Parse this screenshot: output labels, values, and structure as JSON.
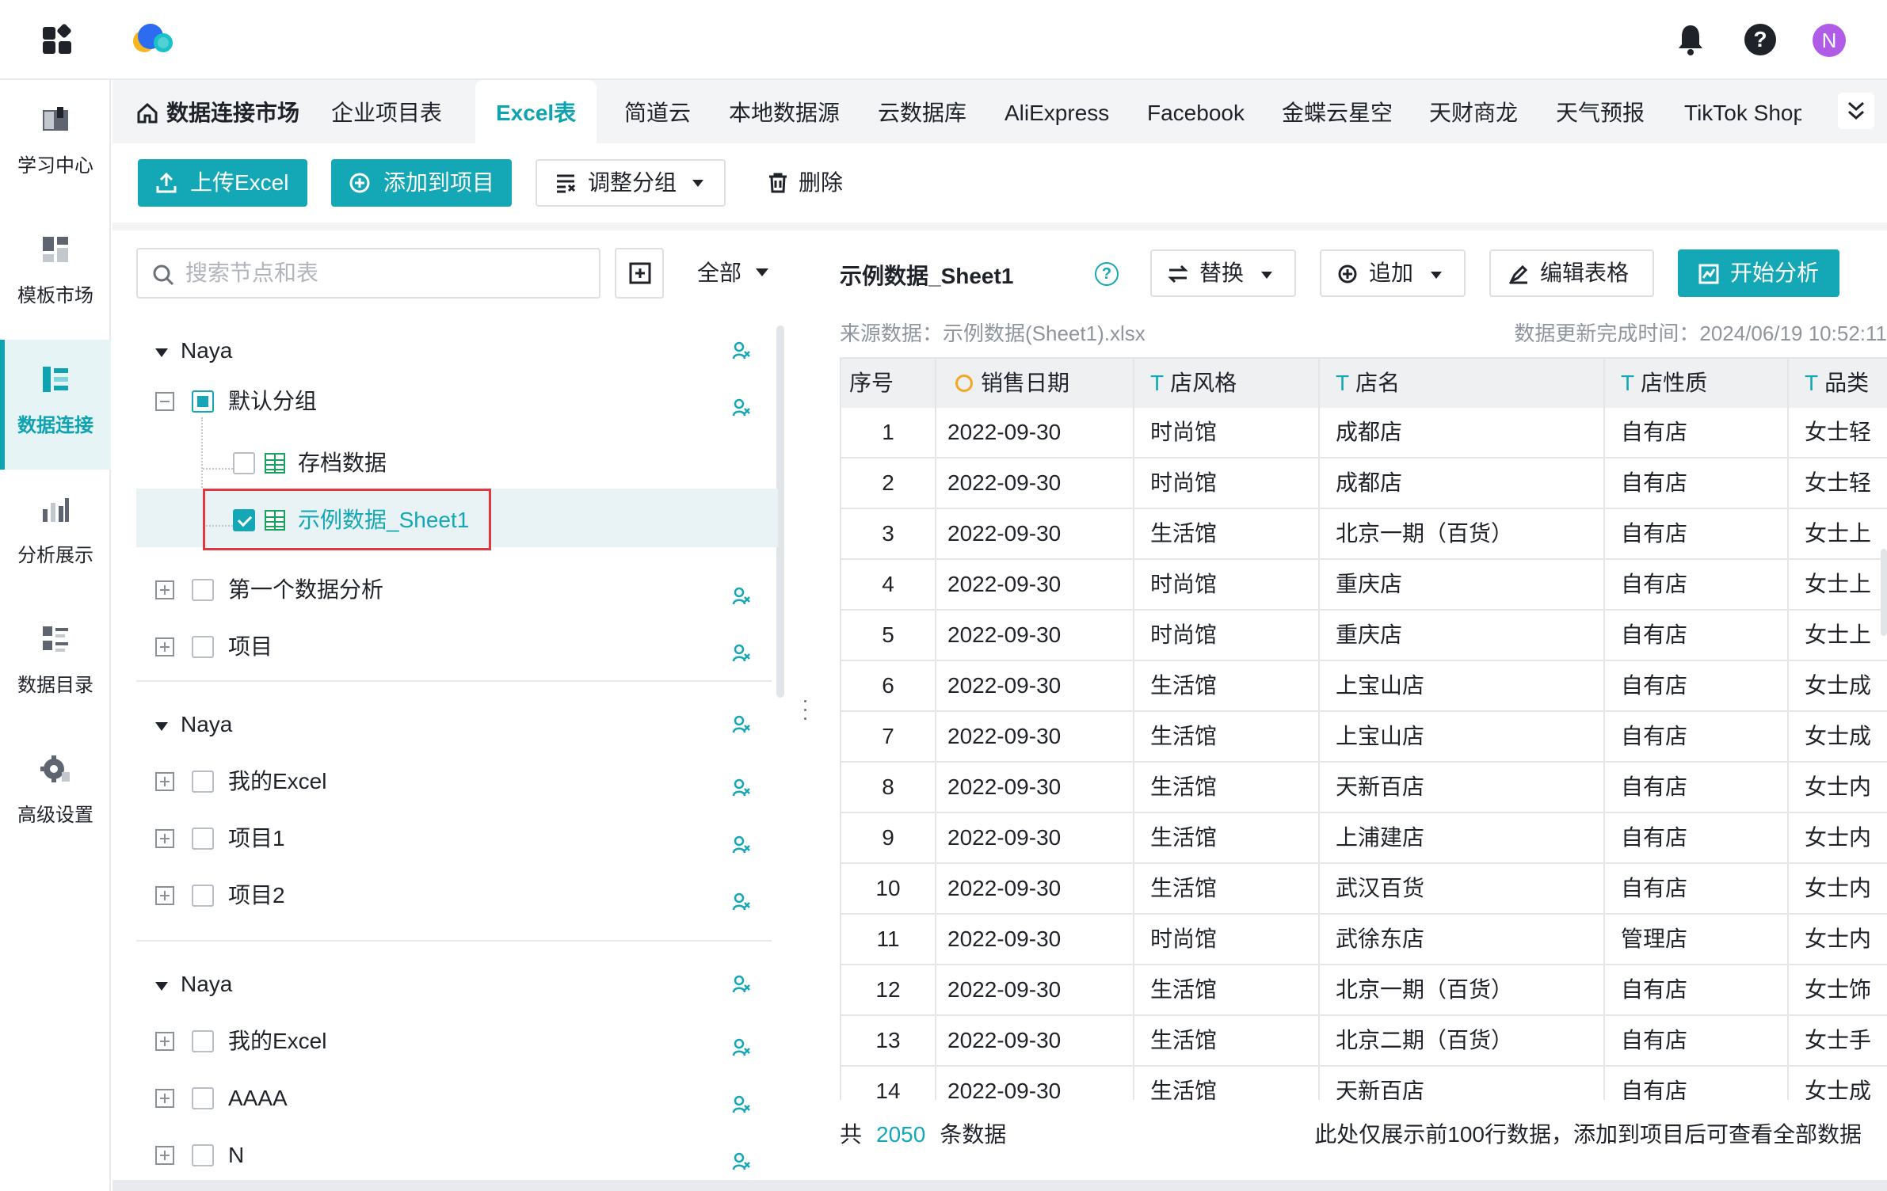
{
  "topbar": {
    "icons": [
      "apps-grid-icon",
      "cloud-logo-icon",
      "bell-icon",
      "help-icon",
      "user-avatar"
    ],
    "help_glyph": "?",
    "avatar_letter": "N"
  },
  "sidebar": {
    "items": [
      {
        "label": "学习中心",
        "icon": "book-icon"
      },
      {
        "label": "模板市场",
        "icon": "template-icon"
      },
      {
        "label": "数据连接",
        "icon": "data-connect-icon",
        "active": true
      },
      {
        "label": "分析展示",
        "icon": "chart-icon"
      },
      {
        "label": "数据目录",
        "icon": "catalog-icon"
      },
      {
        "label": "高级设置",
        "icon": "gear-icon"
      }
    ]
  },
  "tabs": {
    "home": "数据连接市场",
    "items": [
      "企业项目表",
      "Excel表",
      "简道云",
      "本地数据源",
      "云数据库",
      "AliExpress",
      "Facebook",
      "金蝶云星空",
      "天财商龙",
      "天气预报",
      "TikTok Shop"
    ],
    "active": "Excel表"
  },
  "toolbar": {
    "upload": "上传Excel",
    "add_to_project": "添加到项目",
    "adjust_group": "调整分组",
    "delete": "删除"
  },
  "tree": {
    "search_placeholder": "搜索节点和表",
    "filter": "全部",
    "sections": [
      {
        "owner": "Naya",
        "nodes": [
          {
            "label": "默认分组",
            "state": "partial",
            "expand": "minus"
          },
          {
            "label": "存档数据",
            "state": "unchecked",
            "leaf": true
          },
          {
            "label": "示例数据_Sheet1",
            "state": "checked",
            "leaf": true,
            "selected": true
          },
          {
            "label": "第一个数据分析",
            "state": "unchecked",
            "expand": "plus"
          },
          {
            "label": "项目",
            "state": "unchecked",
            "expand": "plus"
          }
        ]
      },
      {
        "owner": "Naya",
        "nodes": [
          {
            "label": "我的Excel",
            "state": "unchecked",
            "expand": "plus"
          },
          {
            "label": "项目1",
            "state": "unchecked",
            "expand": "plus"
          },
          {
            "label": "项目2",
            "state": "unchecked",
            "expand": "plus"
          }
        ]
      },
      {
        "owner": "Naya",
        "nodes": [
          {
            "label": "我的Excel",
            "state": "unchecked",
            "expand": "plus"
          },
          {
            "label": "AAAA",
            "state": "unchecked",
            "expand": "plus"
          },
          {
            "label": "N",
            "state": "unchecked",
            "expand": "plus"
          }
        ]
      }
    ]
  },
  "preview": {
    "title": "示例数据_Sheet1",
    "buttons": {
      "replace": "替换",
      "append": "追加",
      "edit_table": "编辑表格",
      "start_analysis": "开始分析"
    },
    "source_label": "来源数据：示例数据(Sheet1).xlsx",
    "update_label": "数据更新完成时间：2024/06/19 10:52:11",
    "columns": [
      {
        "name": "序号",
        "type": ""
      },
      {
        "name": "销售日期",
        "type": "date"
      },
      {
        "name": "店风格",
        "type": "text"
      },
      {
        "name": "店名",
        "type": "text"
      },
      {
        "name": "店性质",
        "type": "text"
      },
      {
        "name": "品类",
        "type": "text"
      }
    ],
    "type_glyph": "T",
    "rows": [
      [
        "1",
        "2022-09-30",
        "时尚馆",
        "成都店",
        "自有店",
        "女士轻"
      ],
      [
        "2",
        "2022-09-30",
        "时尚馆",
        "成都店",
        "自有店",
        "女士轻"
      ],
      [
        "3",
        "2022-09-30",
        "生活馆",
        "北京一期（百货）",
        "自有店",
        "女士上"
      ],
      [
        "4",
        "2022-09-30",
        "时尚馆",
        "重庆店",
        "自有店",
        "女士上"
      ],
      [
        "5",
        "2022-09-30",
        "时尚馆",
        "重庆店",
        "自有店",
        "女士上"
      ],
      [
        "6",
        "2022-09-30",
        "生活馆",
        "上宝山店",
        "自有店",
        "女士成"
      ],
      [
        "7",
        "2022-09-30",
        "生活馆",
        "上宝山店",
        "自有店",
        "女士成"
      ],
      [
        "8",
        "2022-09-30",
        "生活馆",
        "天新百店",
        "自有店",
        "女士内"
      ],
      [
        "9",
        "2022-09-30",
        "生活馆",
        "上浦建店",
        "自有店",
        "女士内"
      ],
      [
        "10",
        "2022-09-30",
        "生活馆",
        "武汉百货",
        "自有店",
        "女士内"
      ],
      [
        "11",
        "2022-09-30",
        "时尚馆",
        "武徐东店",
        "管理店",
        "女士内"
      ],
      [
        "12",
        "2022-09-30",
        "生活馆",
        "北京一期（百货）",
        "自有店",
        "女士饰"
      ],
      [
        "13",
        "2022-09-30",
        "生活馆",
        "北京二期（百货）",
        "自有店",
        "女士手"
      ],
      [
        "14",
        "2022-09-30",
        "生活馆",
        "天新百店",
        "自有店",
        "女士成"
      ]
    ],
    "footer_prefix": "共",
    "total_count": "2050",
    "footer_suffix": "条数据",
    "footer_note": "此处仅展示前100行数据，添加到项目后可查看全部数据"
  }
}
